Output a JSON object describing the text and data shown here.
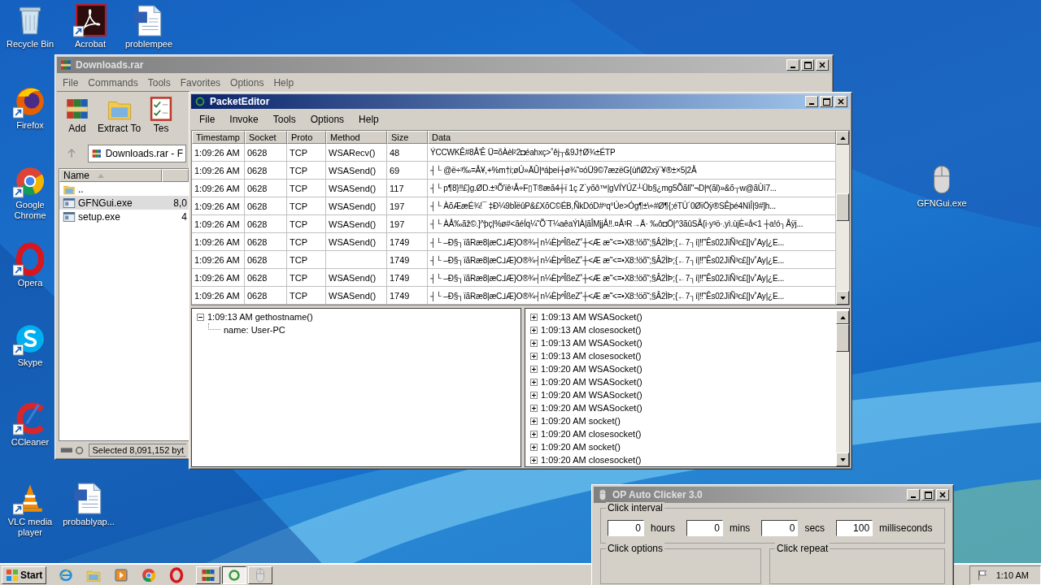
{
  "desktop_icons": [
    {
      "label": "Recycle Bin",
      "kind": "recycle"
    },
    {
      "label": "Acrobat",
      "kind": "acrobat"
    },
    {
      "label": "problempee",
      "kind": "document"
    },
    {
      "label": "Firefox",
      "kind": "firefox"
    },
    {
      "label": "Google Chrome",
      "kind": "chrome"
    },
    {
      "label": "Opera",
      "kind": "opera"
    },
    {
      "label": "Skype",
      "kind": "skype"
    },
    {
      "label": "CCleaner",
      "kind": "ccleaner"
    },
    {
      "label": "VLC media player",
      "kind": "vlc"
    },
    {
      "label": "probablyap...",
      "kind": "document"
    },
    {
      "label": "GFNGui.exe",
      "kind": "mouse"
    }
  ],
  "winrar": {
    "title": "Downloads.rar",
    "menu": [
      "File",
      "Commands",
      "Tools",
      "Favorites",
      "Options",
      "Help"
    ],
    "toolbar": [
      {
        "label": "Add",
        "kind": "archive"
      },
      {
        "label": "Extract To",
        "kind": "folder"
      },
      {
        "label": "Tes",
        "kind": "checklist"
      }
    ],
    "address": "Downloads.rar - F",
    "list_header": "Name",
    "files": [
      {
        "name": "..",
        "kind": "folder",
        "selected": false
      },
      {
        "name": "GFNGui.exe",
        "size": "8,0",
        "kind": "exe",
        "selected": true
      },
      {
        "name": "setup.exe",
        "size": "4",
        "kind": "exe",
        "selected": false
      }
    ],
    "status": "Selected 8,091,152 byt"
  },
  "packet_editor": {
    "title": "PacketEditor",
    "menu": [
      "File",
      "Invoke",
      "Tools",
      "Options",
      "Help"
    ],
    "columns": [
      "Timestamp",
      "Socket",
      "Proto",
      "Method",
      "Size",
      "Data"
    ],
    "rows": [
      {
        "timestamp": "1:09:26 AM",
        "socket": "0628",
        "proto": "TCP",
        "method": "WSARecv()",
        "size": "48",
        "data": "ÝCCWKÊ#8Å'Ê  Ü=õÀèl²2◘éahxç>˚êj┬&9J†Ø¾±ÉTP"
      },
      {
        "timestamp": "1:09:26 AM",
        "socket": "0628",
        "proto": "TCP",
        "method": "WSASend()",
        "size": "69",
        "data": "┤└     @ë÷³‰=Å¥,+%m†i;øÚ»ÄÛ|ªáþeí┼ø¾˜¤óÜ9©7æzëG{ùñØ2xÿ¨¥®±×5|2Å"
      },
      {
        "timestamp": "1:09:26 AM",
        "socket": "0628",
        "proto": "TCP",
        "method": "WSASend()",
        "size": "117",
        "data": "┤└     p¶8}‼£}g.ØD.±³Õ'ïê¹Å÷F▯T®æã4┼ï    1ç  Z`yõð™|gVÍYÚZ┴Üb§¿mg5Õãlî''¬D|ª(ãl)»&õ┬w@ãÙí7..."
      },
      {
        "timestamp": "1:09:26 AM",
        "socket": "0628",
        "proto": "TCP",
        "method": "WSASend()",
        "size": "197",
        "data": "┤└     ÀõÆæÉ¾!¯ ‡Ð¼9bÏëûP&£XõC©ÉB,ÑkDóD#ºq°Úe>Óg¶±\\÷#Ø¶{;éTÙ´0ØïÖÿ®SÊþé4NìÎ|9#]h..."
      },
      {
        "timestamp": "1:09:26 AM",
        "socket": "0628",
        "proto": "TCP",
        "method": "WSASend()",
        "size": "197",
        "data": "┤└     ÀÅ‰ãž©.]^þç|%ø#<ãéÍq¼˜Õ¨T¼aêaÝlÀ|ãÎMjjÅ‼.¤Å³R→Ä· ‰ô◘Ö|^3ãûSÅ{i·y³ö·.yì.ùjÈ«å<1 ┼a!ó┐Åÿj..."
      },
      {
        "timestamp": "1:09:26 AM",
        "socket": "0628",
        "proto": "TCP",
        "method": "WSASend()",
        "size": "1749",
        "data": "┤└  –Ð§┐ïãRæ8|æC⅃Æ}O®¾┤n¼ÈþªÎßeZ˚┼<Æ æ˜<=•X8:!öõ˜;§Â2ÌÞ;{←7┐í|‼˜Ês02JïÑ³c£[|v˚Ay|¿E..."
      },
      {
        "timestamp": "1:09:26 AM",
        "socket": "0628",
        "proto": "TCP",
        "size": "1749",
        "data": "┤└  –Ð§┐ïãRæ8|æC⅃Æ}O®¾┤n¼ÈþªÎßeZ˚┼<Æ æ˜<=•X8:!öõ˜;§Â2ÌÞ;{←7┐í|‼˜Ês02JïÑ³c£[|v˚Ay|¿E..."
      },
      {
        "timestamp": "1:09:26 AM",
        "socket": "0628",
        "proto": "TCP",
        "method": "WSASend()",
        "size": "1749",
        "data": "┤└  –Ð§┐ïãRæ8|æC⅃Æ}O®¾┤n¼ÈþªÎßeZ˚┼<Æ æ˜<=•X8:!öõ˜;§Â2ÌÞ;{←7┐í|‼˜Ês02JïÑ³c£[|v˚Ay|¿E..."
      },
      {
        "timestamp": "1:09:26 AM",
        "socket": "0628",
        "proto": "TCP",
        "method": "WSASend()",
        "size": "1749",
        "data": "┤└  –Ð§┐ïãRæ8|æC⅃Æ}O®¾┤n¼ÈþªÎßeZ˚┼<Æ æ˜<=•X8:!öõ˜;§Â2ÌÞ;{←7┐í|‼˜Ês02JïÑ³c£[|v˚Ay|¿E..."
      }
    ],
    "tree": [
      {
        "label": "1:09:13 AM gethostname()",
        "expanded": true,
        "children": [
          {
            "label": "name: User-PC"
          }
        ]
      }
    ],
    "log": [
      {
        "label": "1:09:13 AM WSASocket()",
        "expanded": false
      },
      {
        "label": "1:09:13 AM closesocket()",
        "expanded": false
      },
      {
        "label": "1:09:13 AM WSASocket()",
        "expanded": false
      },
      {
        "label": "1:09:13 AM closesocket()",
        "expanded": false
      },
      {
        "label": "1:09:20 AM WSASocket()",
        "expanded": false
      },
      {
        "label": "1:09:20 AM WSASocket()",
        "expanded": false
      },
      {
        "label": "1:09:20 AM WSASocket()",
        "expanded": false
      },
      {
        "label": "1:09:20 AM WSASocket()",
        "expanded": false
      },
      {
        "label": "1:09:20 AM socket()",
        "expanded": false
      },
      {
        "label": "1:09:20 AM closesocket()",
        "expanded": false
      },
      {
        "label": "1:09:20 AM socket()",
        "expanded": false
      },
      {
        "label": "1:09:20 AM closesocket()",
        "expanded": false
      }
    ]
  },
  "auto_clicker": {
    "title": "OP Auto Clicker 3.0",
    "interval_group": "Click interval",
    "interval": [
      {
        "value": "0",
        "unit": "hours"
      },
      {
        "value": "0",
        "unit": "mins"
      },
      {
        "value": "0",
        "unit": "secs"
      },
      {
        "value": "100",
        "unit": "milliseconds"
      }
    ],
    "options_group": "Click options",
    "repeat_group": "Click repeat"
  },
  "taskbar": {
    "start": "Start",
    "quick_launch": [
      {
        "kind": "ie"
      },
      {
        "kind": "folder"
      },
      {
        "kind": "media"
      },
      {
        "kind": "chrome"
      },
      {
        "kind": "opera"
      }
    ],
    "windows": [
      {
        "kind": "archive",
        "selected": false
      },
      {
        "kind": "ring",
        "selected": true
      },
      {
        "kind": "mouse",
        "selected": false
      }
    ],
    "clock": "1:10 AM"
  }
}
